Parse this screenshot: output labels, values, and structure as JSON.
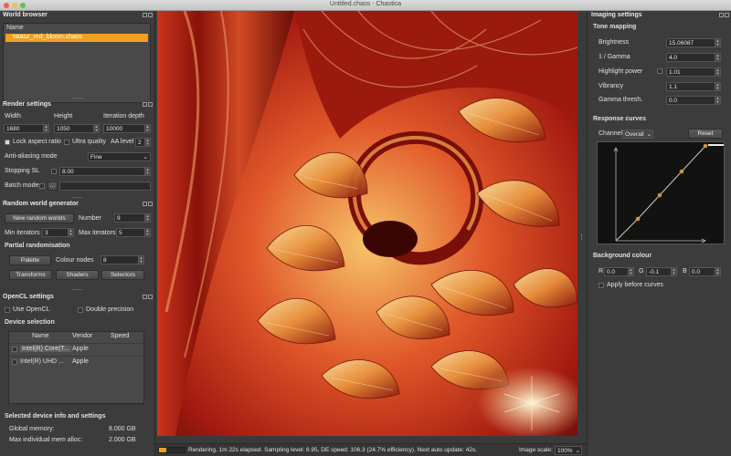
{
  "window": {
    "title": "Untitled.chaos - Chaotica"
  },
  "world_browser": {
    "title": "World browser",
    "column_name": "Name",
    "selected_item": "tatasz_red_bloom.chaos"
  },
  "render_settings": {
    "title": "Render settings",
    "width_label": "Width",
    "height_label": "Height",
    "iter_depth_label": "Iteration depth",
    "width_value": "1680",
    "height_value": "1050",
    "iter_depth_value": "10000",
    "lock_aspect_label": "Lock aspect ratio",
    "ultra_quality_label": "Ultra quality",
    "aa_level_label": "AA level",
    "aa_level_value": "2",
    "antialias_mode_label": "Anti-aliasing mode",
    "antialias_mode_value": "Fine",
    "stopping_sl_label": "Stopping SL",
    "stopping_sl_value": "8.00",
    "batch_mode_label": "Batch mode",
    "batch_mode_btn": "..."
  },
  "random_generator": {
    "title": "Random world generator",
    "new_worlds_btn": "New random worlds",
    "number_label": "Number",
    "number_value": "9",
    "min_iter_label": "Min iterators",
    "min_iter_value": "3",
    "max_iter_label": "Max iterators",
    "max_iter_value": "5",
    "partial_label": "Partial randomisation",
    "palette_btn": "Palette",
    "colour_nodes_label": "Colour nodes",
    "colour_nodes_value": "8",
    "transforms_btn": "Transforms",
    "shaders_btn": "Shaders",
    "selectors_btn": "Selectors"
  },
  "opencl": {
    "title": "OpenCL settings",
    "use_opencl_label": "Use OpenCL",
    "double_precision_label": "Double precision",
    "device_selection_label": "Device selection",
    "col_name": "Name",
    "col_vendor": "Vendor",
    "col_speed": "Speed",
    "devices": [
      {
        "name": "Intel(R) Core(T...",
        "vendor": "Apple",
        "speed": ""
      },
      {
        "name": "Intel(R) UHD ...",
        "vendor": "Apple",
        "speed": ""
      }
    ],
    "device_info_label": "Selected device info and settings",
    "global_mem_label": "Global memory:",
    "global_mem_value": "8.000 GB",
    "max_alloc_label": "Max individual mem alloc:",
    "max_alloc_value": "2.000 GB"
  },
  "imaging": {
    "title": "Imaging settings",
    "tone_mapping_label": "Tone mapping",
    "brightness_label": "Brightness",
    "brightness_value": "15.06087",
    "gamma_label": "1 / Gamma",
    "gamma_value": "4.0",
    "highlight_label": "Highlight power",
    "highlight_value": "1.01",
    "vibrancy_label": "Vibrancy",
    "vibrancy_value": "1.1",
    "gamma_thresh_label": "Gamma thresh.",
    "gamma_thresh_value": "0.0",
    "response_curves_label": "Response curves",
    "channel_label": "Channel:",
    "channel_value": "Overall",
    "reset_btn": "Reset",
    "background_label": "Background colour",
    "r_label": "R",
    "r_value": "0.0",
    "g_label": "G",
    "g_value": "-0.1",
    "b_label": "B",
    "b_value": "0.0",
    "apply_before_label": "Apply before curves"
  },
  "status": {
    "text": "Rendering, 1m 22s elapsed. Sampling level: 6.95, DE speed: 106.3 (24.7% efficiency). Next auto update: 42s.",
    "image_scale_label": "Image scale:",
    "image_scale_value": "100%",
    "progress_fraction": 0.3
  },
  "colors": {
    "accent": "#f0a020",
    "panel": "#3c3c3c",
    "selection": "#f0a020"
  }
}
